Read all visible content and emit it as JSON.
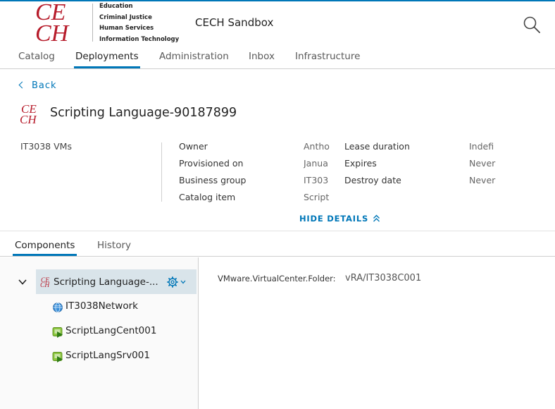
{
  "brand": {
    "logo_text": "CECH",
    "logo_lines": [
      "Education",
      "Criminal Justice",
      "Human Services",
      "Information Technology"
    ],
    "app_title": "CECH Sandbox",
    "accent_color": "#0077b8",
    "logo_color": "#b71c2b"
  },
  "nav": {
    "items": [
      {
        "label": "Catalog",
        "active": false
      },
      {
        "label": "Deployments",
        "active": true
      },
      {
        "label": "Administration",
        "active": false
      },
      {
        "label": "Inbox",
        "active": false
      },
      {
        "label": "Infrastructure",
        "active": false
      }
    ],
    "search_icon": "search-icon"
  },
  "page": {
    "back_label": "Back",
    "title": "Scripting Language-90187899"
  },
  "details": {
    "description": "IT3038 VMs",
    "left_fields": [
      {
        "label": "Owner",
        "value": "Antho"
      },
      {
        "label": "Provisioned on",
        "value": "Janua"
      },
      {
        "label": "Business group",
        "value": "IT303"
      },
      {
        "label": "Catalog item",
        "value": "Script"
      }
    ],
    "right_fields": [
      {
        "label": "Lease duration",
        "value": "Indefi"
      },
      {
        "label": "Expires",
        "value": "Never"
      },
      {
        "label": "Destroy date",
        "value": "Never"
      }
    ],
    "hide_details_label": "HIDE DETAILS"
  },
  "subtabs": [
    {
      "label": "Components",
      "active": true
    },
    {
      "label": "History",
      "active": false
    }
  ],
  "tree": {
    "root": {
      "label": "Scripting Language-...",
      "icon": "cech-logo-icon"
    },
    "children": [
      {
        "label": "IT3038Network",
        "icon": "network-globe-icon"
      },
      {
        "label": "ScriptLangCent001",
        "icon": "vm-icon"
      },
      {
        "label": "ScriptLangSrv001",
        "icon": "vm-icon"
      }
    ]
  },
  "properties": [
    {
      "label": "VMware.VirtualCenter.Folder:",
      "value": "vRA/IT3038C001"
    }
  ]
}
